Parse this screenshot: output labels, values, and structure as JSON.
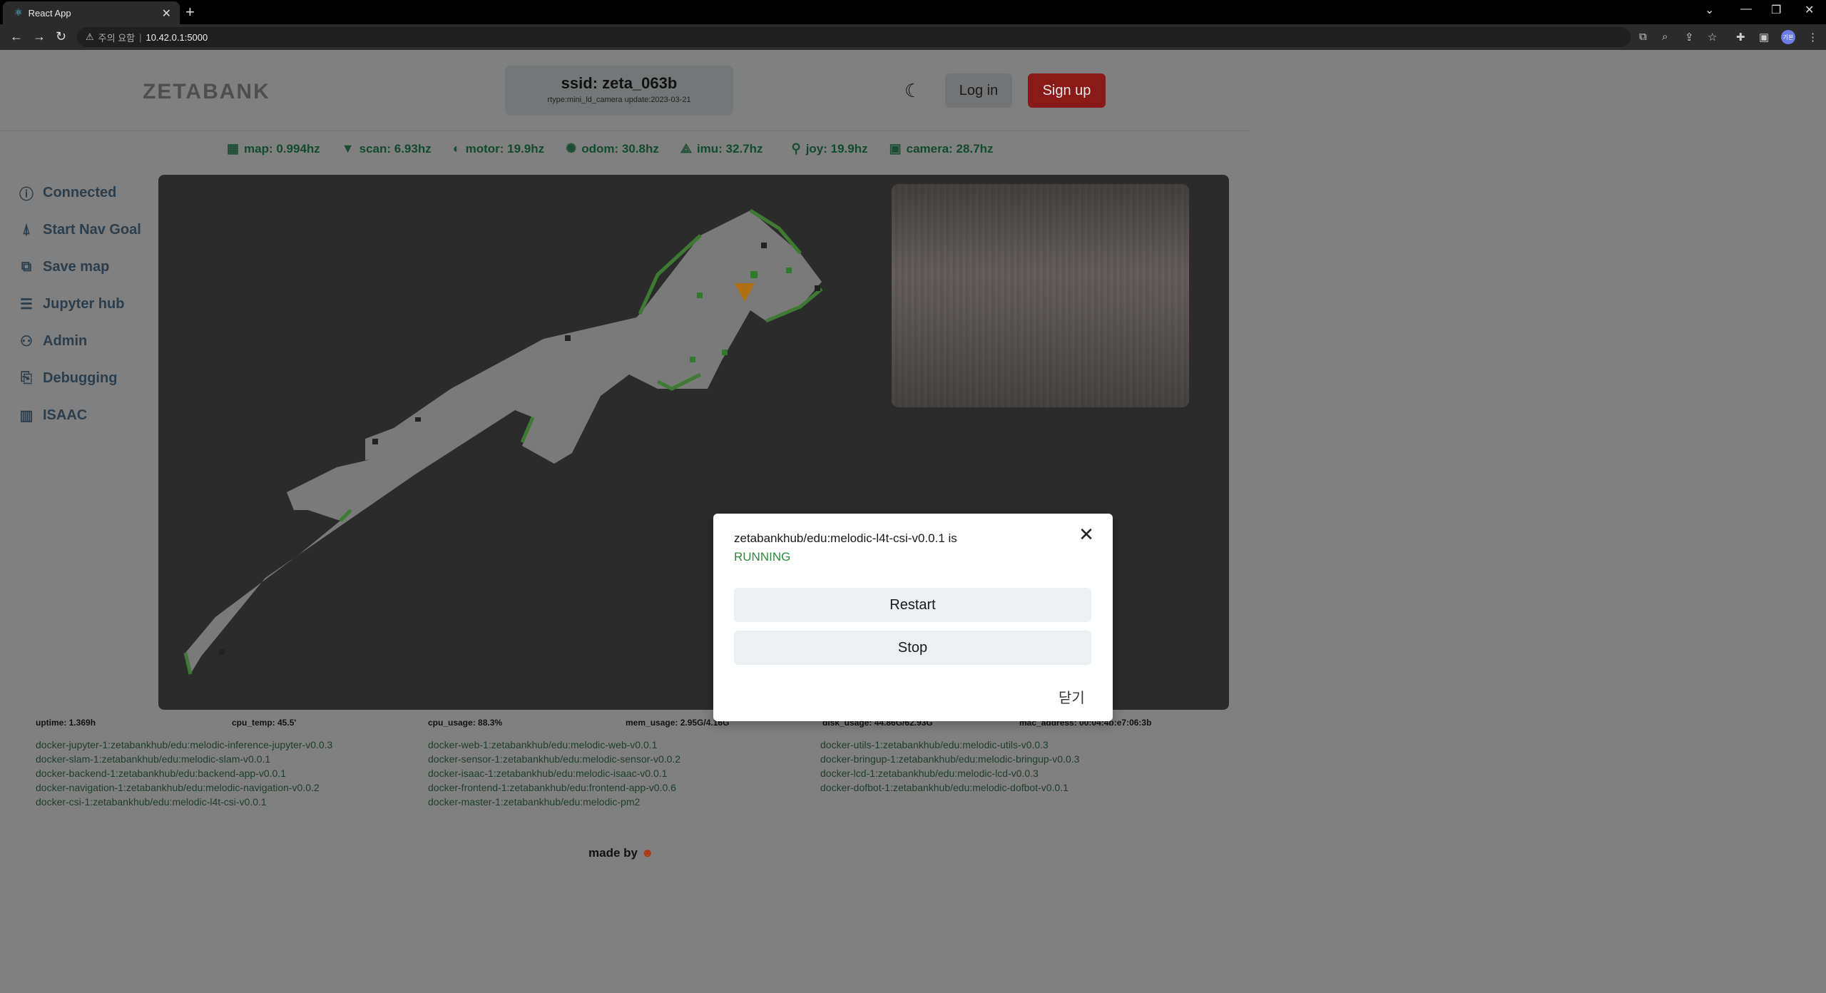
{
  "browser": {
    "tab_title": "React App",
    "warning_text": "주의 요함",
    "url": "10.42.0.1:5000",
    "profile_label": "기본"
  },
  "header": {
    "logo": "ZETABANK",
    "ssid": "ssid: zeta_063b",
    "rtype": "rtype:mini_ld_camera update:2023-03-21",
    "login_label": "Log in",
    "signup_label": "Sign up"
  },
  "stats": [
    {
      "label": "map: 0.994hz",
      "icon": "map-grid-icon"
    },
    {
      "label": "scan: 6.93hz",
      "icon": "wifi-icon"
    },
    {
      "label": "motor: 19.9hz",
      "icon": "motor-icon"
    },
    {
      "label": "odom: 30.8hz",
      "icon": "odom-icon"
    },
    {
      "label": "imu: 32.7hz",
      "icon": "imu-icon"
    },
    {
      "label": "joy: 19.9hz",
      "icon": "joystick-icon"
    },
    {
      "label": "camera: 28.7hz",
      "icon": "camera-icon"
    }
  ],
  "sidebar": {
    "items": [
      {
        "label": "Connected",
        "icon": "connected-icon"
      },
      {
        "label": "Start Nav Goal",
        "icon": "nav-goal-icon"
      },
      {
        "label": "Save map",
        "icon": "save-map-icon"
      },
      {
        "label": "Jupyter hub",
        "icon": "jupyter-icon"
      },
      {
        "label": "Admin",
        "icon": "admin-icon"
      },
      {
        "label": "Debugging",
        "icon": "debugging-icon"
      },
      {
        "label": "ISAAC",
        "icon": "chart-icon"
      }
    ]
  },
  "sysinfo": {
    "uptime": "uptime: 1.369h",
    "cpu_temp": "cpu_temp: 45.5'",
    "cpu_usage": "cpu_usage: 88.3%",
    "mem_usage": "mem_usage: 2.95G/4.16G",
    "disk_usage": "disk_usage: 44.86G/62.93G",
    "mac_address": "mac_address: 00:04:4b:e7:06:3b"
  },
  "containers": {
    "col1": [
      "docker-jupyter-1:zetabankhub/edu:melodic-inference-jupyter-v0.0.3",
      "docker-slam-1:zetabankhub/edu:melodic-slam-v0.0.1",
      "docker-backend-1:zetabankhub/edu:backend-app-v0.0.1",
      "docker-navigation-1:zetabankhub/edu:melodic-navigation-v0.0.2",
      "docker-csi-1:zetabankhub/edu:melodic-l4t-csi-v0.0.1"
    ],
    "col2": [
      "docker-web-1:zetabankhub/edu:melodic-web-v0.0.1",
      "docker-sensor-1:zetabankhub/edu:melodic-sensor-v0.0.2",
      "docker-isaac-1:zetabankhub/edu:melodic-isaac-v0.0.1",
      "docker-frontend-1:zetabankhub/edu:frontend-app-v0.0.6",
      "docker-master-1:zetabankhub/edu:melodic-pm2"
    ],
    "col3": [
      "docker-utils-1:zetabankhub/edu:melodic-utils-v0.0.3",
      "docker-bringup-1:zetabankhub/edu:melodic-bringup-v0.0.3",
      "docker-lcd-1:zetabankhub/edu:melodic-lcd-v0.0.3",
      "docker-dofbot-1:zetabankhub/edu:melodic-dofbot-v0.0.1"
    ]
  },
  "footer": {
    "made_by": "made by"
  },
  "modal": {
    "message": "zetabankhub/edu:melodic-l4t-csi-v0.0.1 is",
    "status": "RUNNING",
    "restart_label": "Restart",
    "stop_label": "Stop",
    "dismiss_label": "닫기"
  },
  "colors": {
    "status_running": "#2d8a3e",
    "signup_bg": "#8a1a17",
    "stats_text": "#114a2c"
  }
}
